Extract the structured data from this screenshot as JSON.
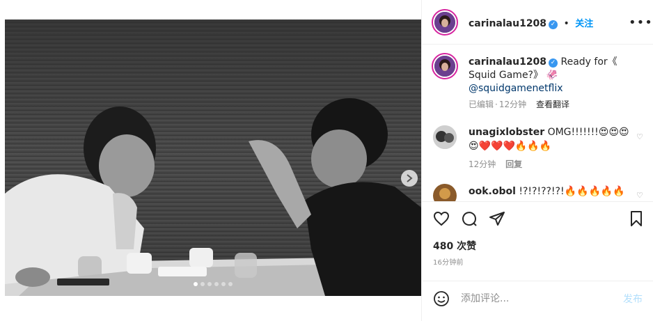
{
  "post": {
    "author": "carinalau1208",
    "follow_label": "关注",
    "bullet": "•",
    "more": "•••"
  },
  "caption": {
    "username": "carinalau1208",
    "text": "Ready for《 Squid Game?》 🦑",
    "mention": "@squidgamenetflix",
    "edited": "已编辑",
    "time": "12分钟",
    "translate": "查看翻译"
  },
  "comments": [
    {
      "username": "unagixlobster",
      "text": "OMG!!!!!!!😍😍😍😍❤️❤️❤️🔥🔥🔥",
      "time": "12分钟",
      "reply": "回复"
    },
    {
      "username": "ook.obol",
      "text": "!?!?!??!?!🔥🔥🔥🔥🔥"
    }
  ],
  "engagement": {
    "likes": "480 次赞",
    "time_ago": "16分钟前"
  },
  "add_comment": {
    "placeholder": "添加评论...",
    "post_label": "发布"
  },
  "carousel": {
    "slide_count": 6,
    "active_index": 0
  }
}
